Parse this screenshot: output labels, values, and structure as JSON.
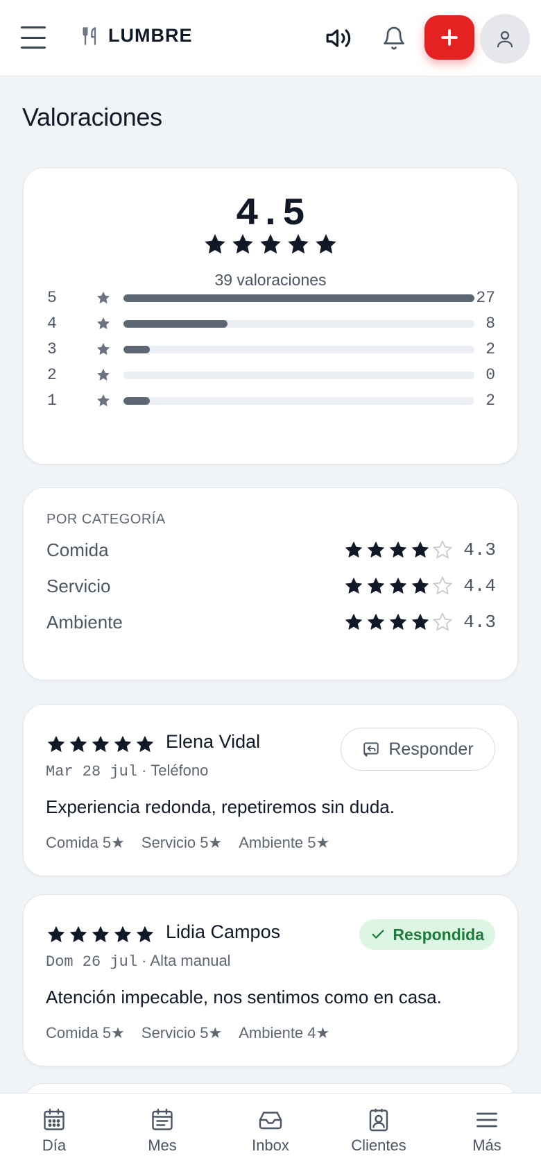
{
  "header": {
    "brand": "LUMBRE",
    "icons": [
      "menu-icon",
      "utensils-icon",
      "speaker-icon",
      "bell-icon",
      "plus-icon",
      "user-icon"
    ],
    "accent_color": "#e42222"
  },
  "page": {
    "title": "Valoraciones"
  },
  "summary": {
    "average": "4.5",
    "average_value": 4.5,
    "total_label": "39 valoraciones",
    "distribution": [
      {
        "stars": "5",
        "count": "27",
        "value": 27
      },
      {
        "stars": "4",
        "count": "8",
        "value": 8
      },
      {
        "stars": "3",
        "count": "2",
        "value": 2
      },
      {
        "stars": "2",
        "count": "0",
        "value": 0
      },
      {
        "stars": "1",
        "count": "2",
        "value": 2
      }
    ],
    "max_count": 27
  },
  "categories": {
    "title": "POR CATEGORÍA",
    "items": [
      {
        "name": "Comida",
        "value": "4.3",
        "stars_filled": 4
      },
      {
        "name": "Servicio",
        "value": "4.4",
        "stars_filled": 4
      },
      {
        "name": "Ambiente",
        "value": "4.3",
        "stars_filled": 4
      }
    ]
  },
  "reviews": [
    {
      "name": "Elena Vidal",
      "stars": 5,
      "date": "Mar 28 jul",
      "separator": "·",
      "source": "Teléfono",
      "text": "Experiencia redonda, repetiremos sin duda.",
      "cats": [
        "Comida 5★",
        "Servicio 5★",
        "Ambiente 5★"
      ],
      "action_label": "Responder"
    },
    {
      "name": "Lidia Campos",
      "stars": 5,
      "date": "Dom 26 jul",
      "separator": "·",
      "source": "Alta manual",
      "text": "Atención impecable, nos sentimos como en casa.",
      "cats": [
        "Comida 5★",
        "Servicio 5★",
        "Ambiente 4★"
      ],
      "status_label": "Respondida",
      "status_color": "#1d7a3a"
    }
  ],
  "nav": {
    "items": [
      {
        "label": "Día",
        "icon": "calendar-day-icon"
      },
      {
        "label": "Mes",
        "icon": "calendar-month-icon"
      },
      {
        "label": "Inbox",
        "icon": "inbox-icon"
      },
      {
        "label": "Clientes",
        "icon": "contacts-icon"
      },
      {
        "label": "Más",
        "icon": "more-menu-icon"
      }
    ]
  }
}
